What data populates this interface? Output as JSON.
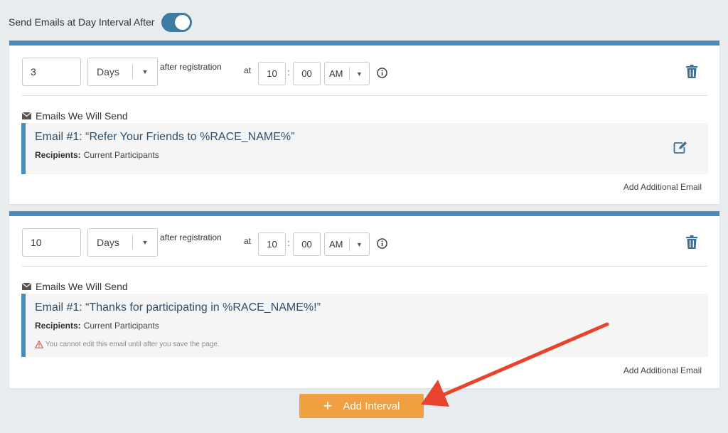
{
  "header": {
    "toggle_label": "Send Emails at Day Interval After",
    "toggle_on": true
  },
  "intervals": [
    {
      "days_value": "3",
      "unit": "Days",
      "after_label": "after registration",
      "at_label": "at",
      "hour": "10",
      "minute": "00",
      "colon": ":",
      "ampm": "AM",
      "emails_heading": "Emails We Will Send",
      "email_title": "Email #1: “Refer Your Friends to %RACE_NAME%”",
      "recipients_label": "Recipients:",
      "recipients_value": "Current Participants",
      "add_email_label": "Add Additional Email"
    },
    {
      "days_value": "10",
      "unit": "Days",
      "after_label": "after registration",
      "at_label": "at",
      "hour": "10",
      "minute": "00",
      "colon": ":",
      "ampm": "AM",
      "emails_heading": "Emails We Will Send",
      "email_title": "Email #1: “Thanks for participating in %RACE_NAME%!”",
      "recipients_label": "Recipients:",
      "recipients_value": "Current Participants",
      "warning_text": "You cannot edit this email until after you save the page.",
      "add_email_label": "Add Additional Email"
    }
  ],
  "add_interval": {
    "plus": "+",
    "label": "Add Interval"
  },
  "icons": {
    "trash": "trash-icon",
    "info": "info-icon",
    "mail": "mail-icon",
    "edit": "edit-icon",
    "warning": "warning-icon",
    "caret": "chevron-down-icon"
  },
  "colors": {
    "accent_blue": "#4a8cbb",
    "toggle_blue": "#3d7ba0",
    "button_orange": "#f0a040",
    "arrow_red": "#e8432d",
    "warning_red": "#d9534f"
  }
}
